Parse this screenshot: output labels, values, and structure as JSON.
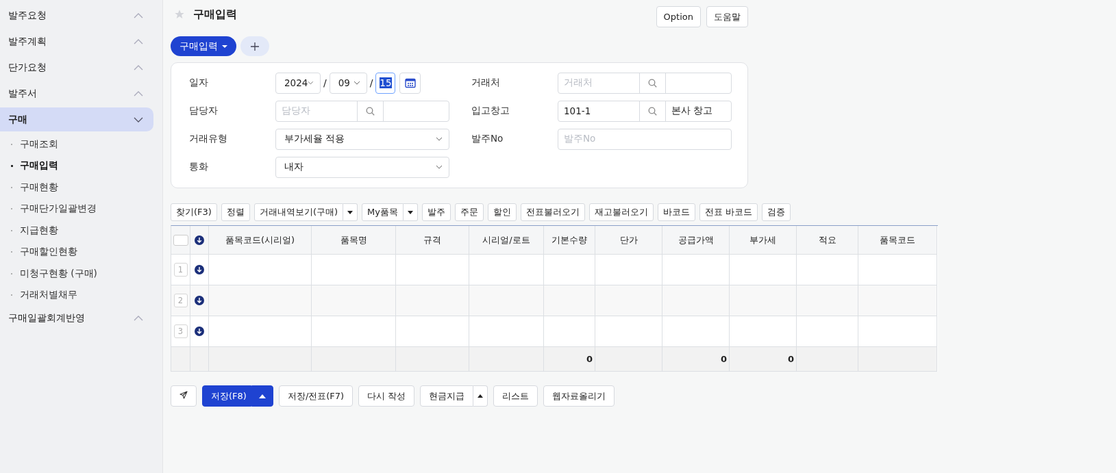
{
  "sidebar": {
    "items": [
      {
        "label": "발주요청",
        "expanded": false,
        "selected": false
      },
      {
        "label": "발주계획",
        "expanded": false,
        "selected": false
      },
      {
        "label": "단가요청",
        "expanded": false,
        "selected": false
      },
      {
        "label": "발주서",
        "expanded": false,
        "selected": false
      },
      {
        "label": "구매",
        "expanded": true,
        "selected": true,
        "children": [
          {
            "label": "구매조회",
            "selected": false
          },
          {
            "label": "구매입력",
            "selected": true
          },
          {
            "label": "구매현황",
            "selected": false
          },
          {
            "label": "구매단가일괄변경",
            "selected": false
          },
          {
            "label": "지급현황",
            "selected": false
          },
          {
            "label": "구매할인현황",
            "selected": false
          },
          {
            "label": "미청구현황 (구매)",
            "selected": false
          },
          {
            "label": "거래처별채무",
            "selected": false
          }
        ]
      },
      {
        "label": "구매일괄회계반영",
        "expanded": false,
        "selected": false
      }
    ]
  },
  "page": {
    "title": "구매입력",
    "favorite": false,
    "header_buttons": [
      "Option",
      "도움말"
    ]
  },
  "tabs": [
    {
      "label": "구매입력",
      "selected": true
    }
  ],
  "form": {
    "left": [
      {
        "kind": "date",
        "label": "일자",
        "year": "2024",
        "separator_1": "/",
        "month": "09",
        "separator_2": "/",
        "day": "15",
        "day_highlighted": true
      },
      {
        "kind": "search",
        "label": "담당자",
        "placeholder": "담당자"
      },
      {
        "kind": "select",
        "label": "거래유형",
        "value": "부가세율 적용"
      },
      {
        "kind": "select",
        "label": "통화",
        "value": "내자"
      }
    ],
    "right": [
      {
        "kind": "search",
        "label": "거래처",
        "placeholder": "거래처"
      },
      {
        "kind": "search",
        "label": "입고창고",
        "value": "101-1",
        "name": "본사 창고"
      },
      {
        "kind": "text",
        "label": "발주No",
        "placeholder": "발주No"
      }
    ]
  },
  "toolbar": [
    {
      "kind": "button",
      "label": "찾기(F3)"
    },
    {
      "kind": "button",
      "label": "정렬"
    },
    {
      "kind": "split",
      "label": "거래내역보기(구매)"
    },
    {
      "kind": "split",
      "label": "My품목"
    },
    {
      "kind": "button",
      "label": "발주"
    },
    {
      "kind": "button",
      "label": "주문"
    },
    {
      "kind": "button",
      "label": "할인"
    },
    {
      "kind": "button",
      "label": "전표불러오기"
    },
    {
      "kind": "button",
      "label": "재고불러오기"
    },
    {
      "kind": "button",
      "label": "바코드"
    },
    {
      "kind": "button",
      "label": "전표 바코드"
    },
    {
      "kind": "button",
      "label": "검증"
    }
  ],
  "table": {
    "select_all": false,
    "columns": [
      {
        "label": "품목코드(시리얼)"
      },
      {
        "label": "품목명"
      },
      {
        "label": "규격"
      },
      {
        "label": "시리얼/로트"
      },
      {
        "label": "기본수량",
        "total": "0"
      },
      {
        "label": "단가"
      },
      {
        "label": "공급가액",
        "total": "0"
      },
      {
        "label": "부가세",
        "total": "0"
      },
      {
        "label": "적요"
      },
      {
        "label": "품목코드"
      }
    ],
    "rows": [
      {
        "number": "1"
      },
      {
        "number": "2"
      },
      {
        "number": "3"
      }
    ]
  },
  "bottom_buttons": [
    {
      "kind": "icon"
    },
    {
      "kind": "primary-split",
      "label": "저장(F8)"
    },
    {
      "kind": "button",
      "label": "저장/전표(F7)"
    },
    {
      "kind": "button",
      "label": "다시 작성"
    },
    {
      "kind": "split",
      "label": "현금지급"
    },
    {
      "kind": "button",
      "label": "리스트"
    },
    {
      "kind": "button",
      "label": "웹자료올리기"
    }
  ]
}
